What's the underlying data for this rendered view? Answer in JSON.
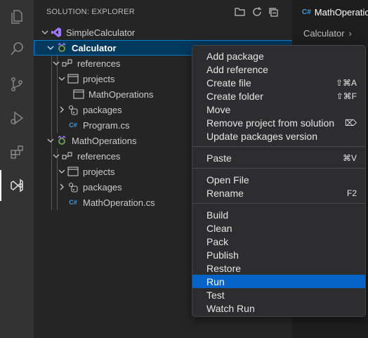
{
  "explorer": {
    "title": "SOLUTION: EXPLORER",
    "tree": [
      {
        "label": "SimpleCalculator"
      },
      {
        "label": "Calculator"
      },
      {
        "label": "references"
      },
      {
        "label": "projects"
      },
      {
        "label": "MathOperations"
      },
      {
        "label": "packages"
      },
      {
        "label": "Program.cs"
      },
      {
        "label": "MathOperations"
      },
      {
        "label": "references"
      },
      {
        "label": "projects"
      },
      {
        "label": "packages"
      },
      {
        "label": "MathOperation.cs"
      }
    ]
  },
  "editor": {
    "tab_label": "MathOperatio",
    "breadcrumb": "Calculator",
    "cs_badge": "C#"
  },
  "context_menu": {
    "items": [
      {
        "label": "Add package",
        "shortcut": ""
      },
      {
        "label": "Add reference",
        "shortcut": ""
      },
      {
        "label": "Create file",
        "shortcut": "⇧⌘A"
      },
      {
        "label": "Create folder",
        "shortcut": "⇧⌘F"
      },
      {
        "label": "Move",
        "shortcut": ""
      },
      {
        "label": "Remove project from solution",
        "shortcut": "⌦"
      },
      {
        "label": "Update packages version",
        "shortcut": ""
      },
      {
        "label": "Paste",
        "shortcut": "⌘V"
      },
      {
        "label": "Open File",
        "shortcut": ""
      },
      {
        "label": "Rename",
        "shortcut": "F2"
      },
      {
        "label": "Build",
        "shortcut": ""
      },
      {
        "label": "Clean",
        "shortcut": ""
      },
      {
        "label": "Pack",
        "shortcut": ""
      },
      {
        "label": "Publish",
        "shortcut": ""
      },
      {
        "label": "Restore",
        "shortcut": ""
      },
      {
        "label": "Run",
        "shortcut": ""
      },
      {
        "label": "Test",
        "shortcut": ""
      },
      {
        "label": "Watch Run",
        "shortcut": ""
      }
    ],
    "hovered_item": "Run"
  },
  "colors": {
    "accent": "#0664c9",
    "selection": "#04395e",
    "vs_purple": "#a277ff"
  }
}
